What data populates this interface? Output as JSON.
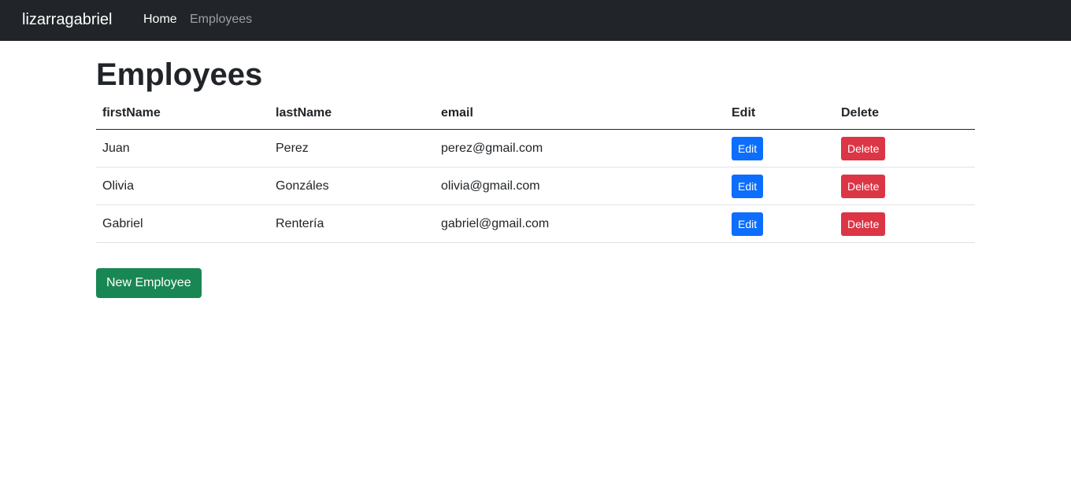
{
  "navbar": {
    "brand": "lizarragabriel",
    "links": [
      {
        "label": "Home"
      },
      {
        "label": "Employees"
      }
    ]
  },
  "page": {
    "title": "Employees"
  },
  "table": {
    "headers": [
      "firstName",
      "lastName",
      "email",
      "Edit",
      "Delete"
    ],
    "rows": [
      {
        "firstName": "Juan",
        "lastName": "Perez",
        "email": "perez@gmail.com",
        "edit_label": "Edit",
        "delete_label": "Delete"
      },
      {
        "firstName": "Olivia",
        "lastName": "Gonzáles",
        "email": "olivia@gmail.com",
        "edit_label": "Edit",
        "delete_label": "Delete"
      },
      {
        "firstName": "Gabriel",
        "lastName": "Rentería",
        "email": "gabriel@gmail.com",
        "edit_label": "Edit",
        "delete_label": "Delete"
      }
    ]
  },
  "actions": {
    "new_employee_label": "New Employee"
  },
  "colors": {
    "navbar_bg": "#212529",
    "edit": "#0d6efd",
    "delete": "#dc3545",
    "new": "#198754"
  }
}
